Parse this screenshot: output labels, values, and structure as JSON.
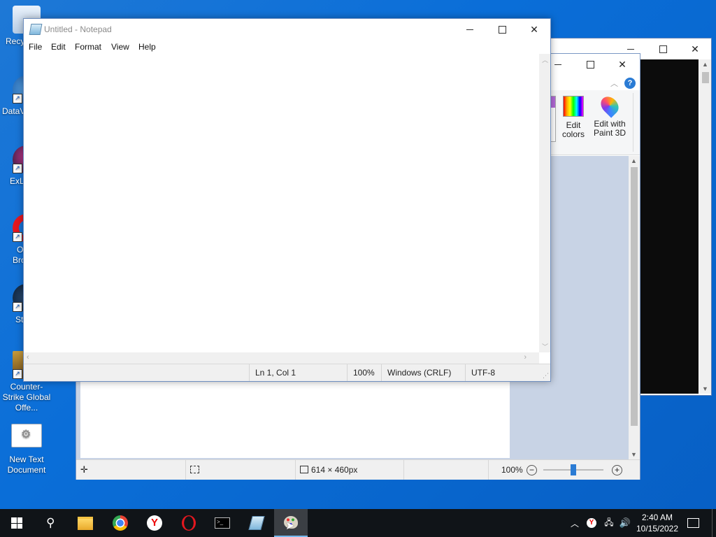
{
  "desktop": {
    "icons": [
      {
        "label": "Recy"
      },
      {
        "label": "DataV"
      },
      {
        "label": "ExL"
      },
      {
        "label": "O"
      },
      {
        "label": "Bro"
      },
      {
        "label": "St"
      },
      {
        "label": "Counter-Strike Global Offe..."
      },
      {
        "label": "New Text Document"
      }
    ]
  },
  "notepad": {
    "title": "Untitled - Notepad",
    "menu": [
      "File",
      "Edit",
      "Format",
      "View",
      "Help"
    ],
    "status": {
      "position": "Ln 1, Col 1",
      "zoom": "100%",
      "line_ending": "Windows (CRLF)",
      "encoding": "UTF-8"
    }
  },
  "paint": {
    "ribbon": {
      "edit_colors": "Edit colors",
      "edit_paint3d": "Edit with Paint 3D"
    },
    "status": {
      "size": "614 × 460px",
      "zoom": "100%"
    },
    "zoom_slider": 0.5
  },
  "taskbar": {
    "clock_time": "2:40 AM",
    "clock_date": "10/15/2022"
  },
  "colors": {
    "desktop_accent": "#0a6ed8",
    "taskbar_bg": "#101418"
  }
}
